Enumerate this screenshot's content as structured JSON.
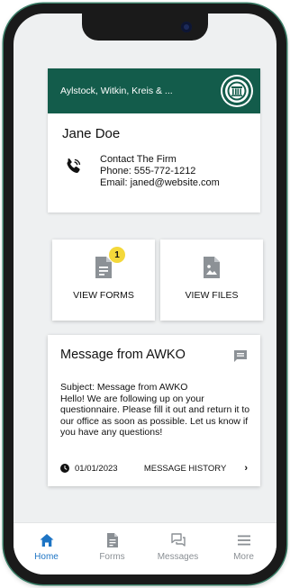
{
  "firm": {
    "name": "Aylstock, Witkin, Kreis & ...",
    "client_name": "Jane Doe",
    "contact_title": "Contact The Firm",
    "phone": "Phone: 555-772-1212",
    "email": "Email: janed@website.com"
  },
  "tiles": {
    "forms_label": "VIEW FORMS",
    "forms_badge": "1",
    "files_label": "VIEW FILES"
  },
  "message": {
    "title": "Message from AWKO",
    "subject": "Subject: Message from AWKO",
    "body": "Hello! We are following up on your questionnaire. Please fill it out and return it to our office as soon as possible. Let us know if you have any questions!",
    "date": "01/01/2023",
    "history_label": "MESSAGE HISTORY",
    "chevron": "›"
  },
  "tabs": [
    {
      "label": "Home",
      "icon": "home-icon",
      "active": true
    },
    {
      "label": "Forms",
      "icon": "document-icon",
      "active": false
    },
    {
      "label": "Messages",
      "icon": "chat-icon",
      "active": false
    },
    {
      "label": "More",
      "icon": "menu-icon",
      "active": false
    }
  ],
  "colors": {
    "header": "#135c4b",
    "badge": "#f4d83a",
    "active_tab": "#1d74c4",
    "inactive_tab": "#8a8f94"
  }
}
